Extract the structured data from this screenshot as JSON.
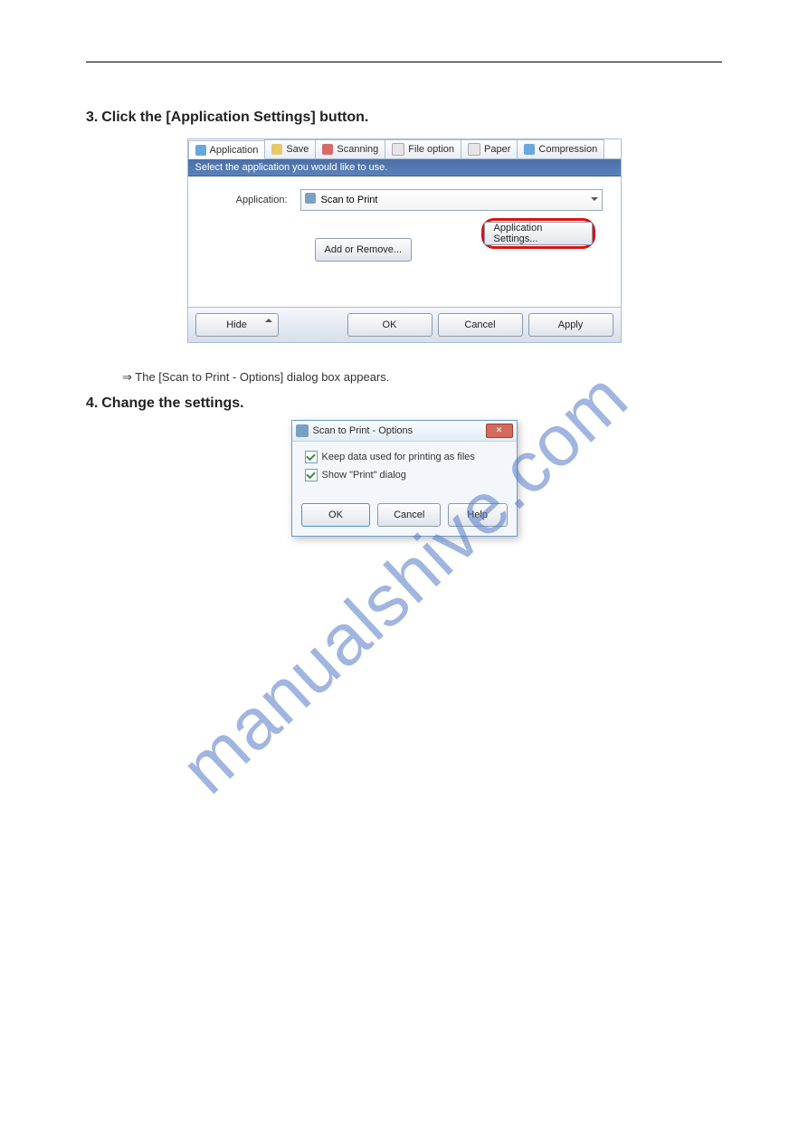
{
  "watermark": "manualshive.com",
  "step3": {
    "num": "3.",
    "text": "Click the [Application Settings] button."
  },
  "dlg1": {
    "tabs": [
      "Application",
      "Save",
      "Scanning",
      "File option",
      "Paper",
      "Compression"
    ],
    "bluebar": "Select the application you would like to use.",
    "app_label": "Application:",
    "app_select": "Scan to Print",
    "btn_appset": "Application Settings...",
    "btn_addrem": "Add or Remove...",
    "btn_hide": "Hide",
    "btn_ok": "OK",
    "btn_cancel": "Cancel",
    "btn_apply": "Apply"
  },
  "resultline": "⇒ The [Scan to Print - Options] dialog box appears.",
  "step4": {
    "num": "4.",
    "text": "Change the settings."
  },
  "dlg2": {
    "title": "Scan to Print - Options",
    "chk1": "Keep data used for printing as files",
    "chk2": "Show \"Print\" dialog",
    "btn_ok": "OK",
    "btn_cancel": "Cancel",
    "btn_help": "Help"
  }
}
